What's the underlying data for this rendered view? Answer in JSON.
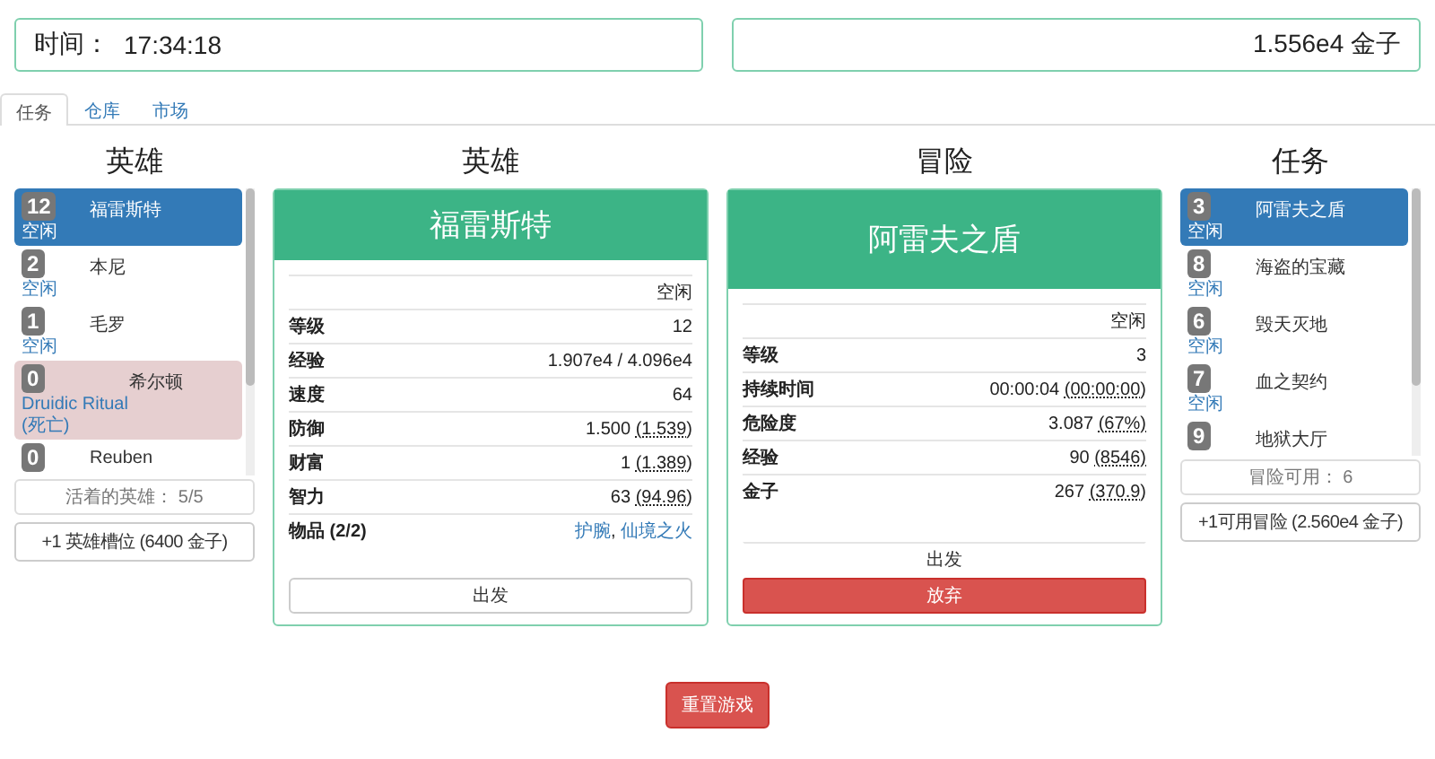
{
  "time_panel": {
    "label": "时间：",
    "value": "17:34:18"
  },
  "gold_panel": {
    "value": "1.556e4 金子"
  },
  "tabs": [
    {
      "label": "任务",
      "selected": true
    },
    {
      "label": "仓库",
      "selected": false
    },
    {
      "label": "市场",
      "selected": false
    }
  ],
  "heroes": {
    "title": "英雄",
    "items": [
      {
        "level": "12",
        "name": "福雷斯特",
        "status": "空闲",
        "selected": true,
        "dead": false
      },
      {
        "level": "2",
        "name": "本尼",
        "status": "空闲",
        "selected": false,
        "dead": false
      },
      {
        "level": "1",
        "name": "毛罗",
        "status": "空闲",
        "selected": false,
        "dead": false
      },
      {
        "level": "0",
        "name": "希尔顿",
        "status": "Druidic Ritual",
        "note": "(死亡)",
        "selected": false,
        "dead": true
      },
      {
        "level": "0",
        "name": "Reuben",
        "selected": false,
        "dead": false
      }
    ],
    "footer": "活着的英雄：  5/5",
    "buy_button": "+1 英雄槽位 (6400 金子)"
  },
  "hero_detail": {
    "title": "英雄",
    "name": "福雷斯特",
    "status": "空闲",
    "rows": [
      {
        "label": "等级",
        "value": "12"
      },
      {
        "label": "经验",
        "value": "1.907e4 / 4.096e4"
      },
      {
        "label": "速度",
        "value": "64"
      },
      {
        "label": "防御",
        "value": "1.500",
        "detail": "(1.539)"
      },
      {
        "label": "财富",
        "value": "1",
        "detail": "(1.389)"
      },
      {
        "label": "智力",
        "value": "63",
        "detail": "(94.96)"
      }
    ],
    "items_label": "物品 (2/2)",
    "items": [
      "护腕",
      "仙境之火"
    ],
    "item_separator": ",",
    "depart_button": "出发"
  },
  "adventure_detail": {
    "title": "冒险",
    "name": "阿雷夫之盾",
    "status": "空闲",
    "rows": [
      {
        "label": "等级",
        "value": "3"
      },
      {
        "label": "持续时间",
        "value": "00:00:04",
        "detail": "(00:00:00)"
      },
      {
        "label": "危险度",
        "value": "3.087",
        "detail": "(67%)"
      },
      {
        "label": "经验",
        "value": "90",
        "detail": "(8546)"
      },
      {
        "label": "金子",
        "value": "267",
        "detail": "(370.9)"
      }
    ],
    "depart_button": "出发",
    "abandon_button": "放弃"
  },
  "quests": {
    "title": "任务",
    "items": [
      {
        "level": "3",
        "name": "阿雷夫之盾",
        "status": "空闲",
        "selected": true
      },
      {
        "level": "8",
        "name": "海盗的宝藏",
        "status": "空闲",
        "selected": false
      },
      {
        "level": "6",
        "name": "毁天灭地",
        "status": "空闲",
        "selected": false
      },
      {
        "level": "7",
        "name": "血之契约",
        "status": "空闲",
        "selected": false
      },
      {
        "level": "9",
        "name": "地狱大厅",
        "selected": false
      }
    ],
    "footer": "冒险可用：  6",
    "buy_button": "+1可用冒险 (2.560e4 金子)"
  },
  "reset_button": "重置游戏"
}
